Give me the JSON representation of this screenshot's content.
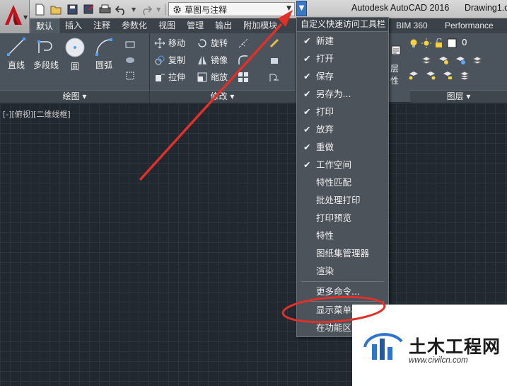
{
  "titlebar": {
    "workspace": "草图与注释",
    "app_title": "Autodesk AutoCAD 2016",
    "doc_title": "Drawing1.d"
  },
  "qat_icons": [
    "new-icon",
    "open-icon",
    "save-icon",
    "save-as-icon",
    "print-icon",
    "undo-icon",
    "redo-icon",
    "gear-icon"
  ],
  "tabs": [
    "默认",
    "插入",
    "注释",
    "参数化",
    "视图",
    "管理",
    "输出",
    "附加模块",
    "BIM 360",
    "Performance"
  ],
  "ribbon": {
    "draw": {
      "line": "直线",
      "polyline": "多段线",
      "circle": "圆",
      "arc": "圆弧",
      "title": "绘图"
    },
    "modify": {
      "move": "移动",
      "rotate": "旋转",
      "copy": "复制",
      "mirror": "镜像",
      "stretch": "拉伸",
      "scale": "缩放",
      "title": "修改"
    },
    "layers": {
      "layer_label_1": "层",
      "layer_label_2": "性",
      "layer_value": "0",
      "title": "图层"
    }
  },
  "viewport": {
    "label": "[-][俯视][二维线框]"
  },
  "menu": {
    "header": "自定义快速访问工具栏",
    "items": [
      {
        "label": "新建",
        "checked": "✔"
      },
      {
        "label": "打开",
        "checked": "✔"
      },
      {
        "label": "保存",
        "checked": "✔"
      },
      {
        "label": "另存为...",
        "checked": "✔"
      },
      {
        "label": "打印",
        "checked": "✔"
      },
      {
        "label": "放弃",
        "checked": "✔"
      },
      {
        "label": "重做",
        "checked": "✔"
      },
      {
        "label": "工作空间",
        "checked": "✔"
      },
      {
        "label": "特性匹配",
        "checked": ""
      },
      {
        "label": "批处理打印",
        "checked": ""
      },
      {
        "label": "打印预览",
        "checked": ""
      },
      {
        "label": "特性",
        "checked": ""
      },
      {
        "label": "图纸集管理器",
        "checked": ""
      },
      {
        "label": "渲染",
        "checked": ""
      }
    ],
    "more": "更多命令...",
    "show_menubar": "显示菜单栏",
    "below_ribbon": "在功能区"
  },
  "watermark": {
    "title": "土木工程网",
    "url": "www.civilcn.com"
  },
  "colors": {
    "annotation_red": "#e0302a",
    "ribbon_bg": "#4b545c",
    "canvas_bg": "#212830",
    "qat_highlight": "#3b78c4"
  }
}
